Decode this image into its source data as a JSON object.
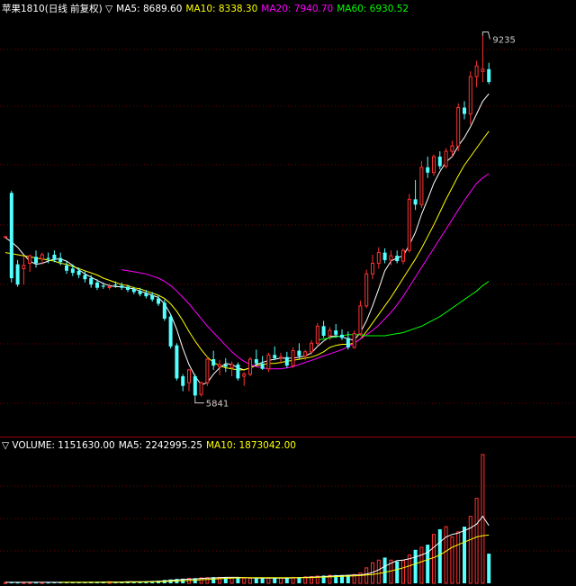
{
  "colors": {
    "background": "#000000",
    "grid": "#7a0000",
    "up": "#ff3232",
    "down": "#54ffff",
    "ma5": "#ffffff",
    "ma10": "#ffff00",
    "ma20": "#ff00ff",
    "ma60": "#00ff00",
    "text": "#ffffff"
  },
  "header": {
    "title": "苹果1810(日线 前复权) ▽",
    "ma5": "MA5: 8689.60",
    "ma10": "MA10: 8338.30",
    "ma20": "MA20: 7940.70",
    "ma60": "MA60: 6930.52"
  },
  "volume_header": {
    "title": "▽ VOLUME: 1151630.00",
    "ma5": "MA5: 2242995.25",
    "ma10": "MA10: 1873042.00"
  },
  "chart_data": [
    {
      "type": "candlestick",
      "title": "苹果1810(日线 前复权)",
      "ylim": [
        5500,
        9400
      ],
      "grid": true,
      "annotations": [
        {
          "label": "9235",
          "value": 9235,
          "index": 78
        },
        {
          "label": "5841",
          "value": 5841,
          "index": 31
        }
      ],
      "candles": [
        [
          7350,
          7350,
          7350,
          7350
        ],
        [
          7760,
          7780,
          6920,
          6960
        ],
        [
          7090,
          7130,
          6880,
          6900
        ],
        [
          7050,
          7170,
          6900,
          7080
        ],
        [
          7100,
          7180,
          7020,
          7170
        ],
        [
          7160,
          7220,
          7060,
          7100
        ],
        [
          7140,
          7200,
          7090,
          7180
        ],
        [
          7150,
          7200,
          7100,
          7140
        ],
        [
          7180,
          7220,
          7110,
          7130
        ],
        [
          7150,
          7200,
          7080,
          7110
        ],
        [
          7080,
          7120,
          7000,
          7030
        ],
        [
          7050,
          7090,
          6980,
          7010
        ],
        [
          7030,
          7060,
          6960,
          6990
        ],
        [
          6990,
          7030,
          6920,
          6950
        ],
        [
          6960,
          6990,
          6870,
          6900
        ],
        [
          6920,
          6950,
          6850,
          6870
        ],
        [
          6890,
          6920,
          6860,
          6880
        ],
        [
          6880,
          6910,
          6850,
          6880
        ],
        [
          6900,
          6930,
          6870,
          6890
        ],
        [
          6890,
          6920,
          6850,
          6870
        ],
        [
          6880,
          6900,
          6830,
          6850
        ],
        [
          6860,
          6880,
          6810,
          6830
        ],
        [
          6840,
          6870,
          6790,
          6810
        ],
        [
          6820,
          6850,
          6770,
          6790
        ],
        [
          6800,
          6830,
          6740,
          6760
        ],
        [
          6770,
          6800,
          6700,
          6720
        ],
        [
          6730,
          6760,
          6560,
          6580
        ],
        [
          6600,
          6620,
          6300,
          6320
        ],
        [
          6330,
          6350,
          6000,
          6020
        ],
        [
          6040,
          6060,
          5900,
          5950
        ],
        [
          5980,
          6110,
          5900,
          6100
        ],
        [
          6040,
          6060,
          5841,
          5860
        ],
        [
          5870,
          5990,
          5850,
          5980
        ],
        [
          5980,
          6230,
          5950,
          6200
        ],
        [
          6200,
          6280,
          6100,
          6140
        ],
        [
          6130,
          6190,
          6050,
          6150
        ],
        [
          6150,
          6210,
          6080,
          6130
        ],
        [
          6120,
          6180,
          6040,
          6150
        ],
        [
          6150,
          6170,
          6000,
          6020
        ],
        [
          6040,
          6080,
          5950,
          6060
        ],
        [
          6060,
          6220,
          6040,
          6200
        ],
        [
          6200,
          6290,
          6150,
          6160
        ],
        [
          6160,
          6230,
          6100,
          6110
        ],
        [
          6110,
          6260,
          6080,
          6240
        ],
        [
          6240,
          6320,
          6190,
          6210
        ],
        [
          6210,
          6260,
          6160,
          6220
        ],
        [
          6220,
          6270,
          6120,
          6140
        ],
        [
          6140,
          6310,
          6120,
          6280
        ],
        [
          6280,
          6350,
          6200,
          6230
        ],
        [
          6230,
          6290,
          6190,
          6270
        ],
        [
          6270,
          6380,
          6240,
          6350
        ],
        [
          6350,
          6540,
          6320,
          6510
        ],
        [
          6510,
          6560,
          6400,
          6420
        ],
        [
          6420,
          6500,
          6380,
          6470
        ],
        [
          6470,
          6530,
          6400,
          6430
        ],
        [
          6430,
          6480,
          6380,
          6400
        ],
        [
          6400,
          6460,
          6290,
          6310
        ],
        [
          6310,
          6470,
          6300,
          6440
        ],
        [
          6440,
          6750,
          6420,
          6700
        ],
        [
          6700,
          7040,
          6680,
          7000
        ],
        [
          7000,
          7180,
          6950,
          7100
        ],
        [
          7100,
          7250,
          7050,
          7200
        ],
        [
          7200,
          7240,
          7100,
          7130
        ],
        [
          7130,
          7220,
          7080,
          7170
        ],
        [
          7170,
          7220,
          7100,
          7120
        ],
        [
          7120,
          7240,
          7090,
          7220
        ],
        [
          7220,
          7750,
          7200,
          7700
        ],
        [
          7700,
          7880,
          7600,
          7650
        ],
        [
          7650,
          8060,
          7620,
          8000
        ],
        [
          8000,
          8100,
          7900,
          7950
        ],
        [
          7950,
          8120,
          7920,
          8100
        ],
        [
          8100,
          8150,
          7980,
          8010
        ],
        [
          8010,
          8180,
          7990,
          8150
        ],
        [
          8150,
          8250,
          8100,
          8200
        ],
        [
          8200,
          8600,
          8150,
          8560
        ],
        [
          8560,
          8620,
          8450,
          8500
        ],
        [
          8500,
          8900,
          8400,
          8850
        ],
        [
          8850,
          9000,
          8750,
          8950
        ],
        [
          8900,
          9235,
          8800,
          8920
        ],
        [
          8920,
          8980,
          8780,
          8800
        ]
      ],
      "series": [
        {
          "name": "MA5",
          "values": [
            7340,
            7300,
            7250,
            7180,
            7120,
            7090,
            7100,
            7120,
            7140,
            7140,
            7120,
            7080,
            7040,
            7000,
            6970,
            6940,
            6910,
            6890,
            6880,
            6880,
            6870,
            6860,
            6840,
            6820,
            6800,
            6780,
            6720,
            6620,
            6480,
            6300,
            6150,
            6040,
            5960,
            5980,
            6060,
            6120,
            6160,
            6150,
            6120,
            6100,
            6120,
            6150,
            6170,
            6190,
            6200,
            6210,
            6210,
            6210,
            6220,
            6230,
            6260,
            6320,
            6370,
            6410,
            6420,
            6410,
            6390,
            6380,
            6450,
            6560,
            6700,
            6860,
            7030,
            7120,
            7150,
            7170,
            7270,
            7390,
            7560,
            7700,
            7850,
            7960,
            8050,
            8100,
            8200,
            8280,
            8380,
            8500,
            8620,
            8689.6
          ]
        },
        {
          "name": "MA10",
          "values": [
            7200,
            7190,
            7180,
            7170,
            7160,
            7150,
            7140,
            7130,
            7120,
            7100,
            7090,
            7070,
            7050,
            7030,
            7010,
            6990,
            6960,
            6940,
            6920,
            6900,
            6890,
            6870,
            6860,
            6840,
            6820,
            6800,
            6770,
            6720,
            6650,
            6560,
            6460,
            6370,
            6290,
            6220,
            6170,
            6140,
            6120,
            6110,
            6100,
            6100,
            6120,
            6140,
            6150,
            6160,
            6160,
            6170,
            6180,
            6190,
            6200,
            6210,
            6220,
            6240,
            6270,
            6310,
            6330,
            6340,
            6340,
            6350,
            6390,
            6460,
            6540,
            6620,
            6700,
            6780,
            6870,
            6960,
            7050,
            7140,
            7240,
            7350,
            7460,
            7580,
            7700,
            7810,
            7920,
            8020,
            8100,
            8180,
            8260,
            8338.3
          ]
        },
        {
          "name": "MA20",
          "values": [
            null,
            null,
            null,
            null,
            null,
            null,
            null,
            null,
            null,
            null,
            null,
            null,
            null,
            null,
            null,
            null,
            null,
            null,
            null,
            7040,
            7030,
            7020,
            7010,
            7000,
            6980,
            6960,
            6930,
            6890,
            6840,
            6780,
            6720,
            6650,
            6580,
            6510,
            6450,
            6390,
            6330,
            6270,
            6220,
            6180,
            6150,
            6130,
            6120,
            6110,
            6110,
            6110,
            6120,
            6130,
            6150,
            6170,
            6190,
            6210,
            6230,
            6250,
            6270,
            6290,
            6320,
            6350,
            6390,
            6430,
            6470,
            6520,
            6580,
            6640,
            6710,
            6790,
            6880,
            6970,
            7060,
            7150,
            7240,
            7330,
            7420,
            7510,
            7600,
            7690,
            7770,
            7850,
            7900,
            7940.7
          ]
        },
        {
          "name": "MA60",
          "values": [
            null,
            null,
            null,
            null,
            null,
            null,
            null,
            null,
            null,
            null,
            null,
            null,
            null,
            null,
            null,
            null,
            null,
            null,
            null,
            null,
            null,
            null,
            null,
            null,
            null,
            null,
            null,
            null,
            null,
            null,
            null,
            null,
            null,
            null,
            null,
            null,
            null,
            null,
            null,
            null,
            null,
            null,
            null,
            null,
            null,
            null,
            null,
            null,
            null,
            null,
            null,
            6380,
            6390,
            6400,
            6410,
            6420,
            6430,
            6430,
            6430,
            6420,
            6420,
            6420,
            6420,
            6430,
            6440,
            6450,
            6470,
            6490,
            6510,
            6540,
            6570,
            6600,
            6640,
            6680,
            6720,
            6760,
            6800,
            6840,
            6890,
            6930.52
          ]
        }
      ]
    },
    {
      "type": "bar",
      "title": "VOLUME",
      "ylim": [
        0,
        5000000
      ],
      "volumes": [
        30000,
        40000,
        30000,
        30000,
        30000,
        30000,
        30000,
        30000,
        40000,
        40000,
        40000,
        50000,
        50000,
        50000,
        60000,
        60000,
        60000,
        60000,
        60000,
        60000,
        70000,
        70000,
        70000,
        80000,
        90000,
        100000,
        130000,
        150000,
        170000,
        180000,
        190000,
        200000,
        210000,
        220000,
        240000,
        230000,
        220000,
        210000,
        200000,
        200000,
        190000,
        190000,
        190000,
        200000,
        200000,
        210000,
        220000,
        230000,
        240000,
        250000,
        260000,
        280000,
        300000,
        310000,
        320000,
        320000,
        330000,
        340000,
        400000,
        600000,
        800000,
        900000,
        1000000,
        900000,
        850000,
        900000,
        1100000,
        1300000,
        1400000,
        1500000,
        1900000,
        2100000,
        2200000,
        1800000,
        2000000,
        2200000,
        2600000,
        3300000,
        5000000,
        1151630
      ],
      "series": [
        {
          "name": "MA5",
          "values": [
            40000,
            40000,
            40000,
            40000,
            40000,
            40000,
            40000,
            40000,
            40000,
            40000,
            40000,
            40000,
            40000,
            40000,
            40000,
            40000,
            50000,
            50000,
            50000,
            50000,
            60000,
            60000,
            60000,
            60000,
            70000,
            80000,
            90000,
            110000,
            130000,
            150000,
            160000,
            170000,
            190000,
            200000,
            210000,
            220000,
            230000,
            230000,
            230000,
            220000,
            210000,
            200000,
            200000,
            200000,
            200000,
            200000,
            200000,
            210000,
            220000,
            230000,
            240000,
            250000,
            260000,
            280000,
            290000,
            300000,
            310000,
            320000,
            330000,
            360000,
            420000,
            520000,
            660000,
            780000,
            880000,
            900000,
            950000,
            1020000,
            1100000,
            1200000,
            1400000,
            1600000,
            1800000,
            1900000,
            1950000,
            2050000,
            2150000,
            2300000,
            2600000,
            2242995.25
          ]
        },
        {
          "name": "MA10",
          "values": [
            null,
            null,
            null,
            null,
            null,
            null,
            null,
            null,
            null,
            40000,
            40000,
            40000,
            40000,
            40000,
            40000,
            40000,
            40000,
            40000,
            40000,
            40000,
            40000,
            50000,
            50000,
            50000,
            60000,
            60000,
            70000,
            80000,
            90000,
            100000,
            110000,
            120000,
            140000,
            150000,
            160000,
            180000,
            190000,
            200000,
            210000,
            220000,
            220000,
            220000,
            220000,
            220000,
            220000,
            220000,
            220000,
            220000,
            220000,
            220000,
            220000,
            230000,
            240000,
            250000,
            260000,
            270000,
            280000,
            290000,
            300000,
            320000,
            340000,
            380000,
            430000,
            480000,
            540000,
            600000,
            680000,
            760000,
            840000,
            920000,
            1000000,
            1100000,
            1250000,
            1400000,
            1500000,
            1600000,
            1700000,
            1800000,
            1850000,
            1873042
          ]
        }
      ]
    }
  ]
}
